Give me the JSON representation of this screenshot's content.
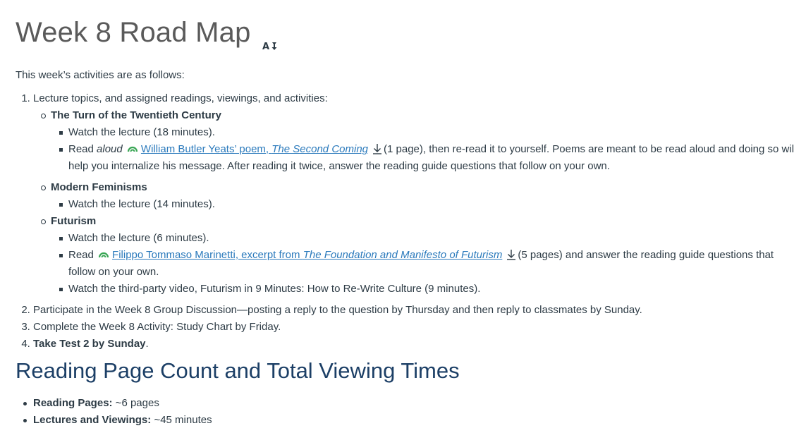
{
  "page": {
    "title": "Week 8 Road Map",
    "title_icon": "immersive-reader-icon",
    "intro": "This week’s activities are as follows:"
  },
  "steps": {
    "step1": {
      "text": "Lecture topics, and assigned readings, viewings, and activities:",
      "topics": [
        {
          "title": "The Turn of the Twentieth Century",
          "items": [
            {
              "text": "Watch the lecture (18 minutes)."
            },
            {
              "pre": "Read ",
              "pre_em": "aloud",
              "link_pre": "William Butler Yeats’ poem, ",
              "link_em": "The Second Coming",
              "post": "(1 page), then re-read it to yourself. Poems are meant to be read aloud and doing so will help you internalize his message. After reading it twice, answer the reading guide questions that follow on your own."
            }
          ]
        },
        {
          "title": "Modern Feminisms",
          "items": [
            {
              "text": "Watch the lecture (14 minutes)."
            }
          ]
        },
        {
          "title": "Futurism",
          "items": [
            {
              "text": "Watch the lecture (6 minutes)."
            },
            {
              "pre": "Read ",
              "link_pre": "Filippo Tommaso Marinetti, excerpt from ",
              "link_em": "The Foundation and Manifesto of Futurism",
              "post": "(5 pages) and answer the reading guide questions that follow on your own."
            },
            {
              "text": "Watch the third-party video, Futurism in 9 Minutes: How to Re-Write Culture (9 minutes)."
            }
          ]
        }
      ]
    },
    "step2": "Participate in the Week 8 Group Discussion—posting a reply to the question by Thursday and then reply to classmates by Sunday.",
    "step3": "Complete the Week 8 Activity: Study Chart by Friday.",
    "step4": {
      "bold": "Take Test 2 by Sunday",
      "tail": "."
    }
  },
  "summary": {
    "heading": "Reading Page Count and Total Viewing Times",
    "items": [
      {
        "label": "Reading Pages:",
        "value": " ~6 pages"
      },
      {
        "label": "Lectures and Viewings:",
        "value": " ~45 minutes"
      }
    ]
  },
  "colors": {
    "text": "#2d3b45",
    "title": "#5a5a5a",
    "heading": "#1c3f66",
    "link": "#2b7abc",
    "cloud_icon": "#3aa655"
  },
  "icons": {
    "link_badge": "cloud-icon",
    "download": "download-icon"
  }
}
